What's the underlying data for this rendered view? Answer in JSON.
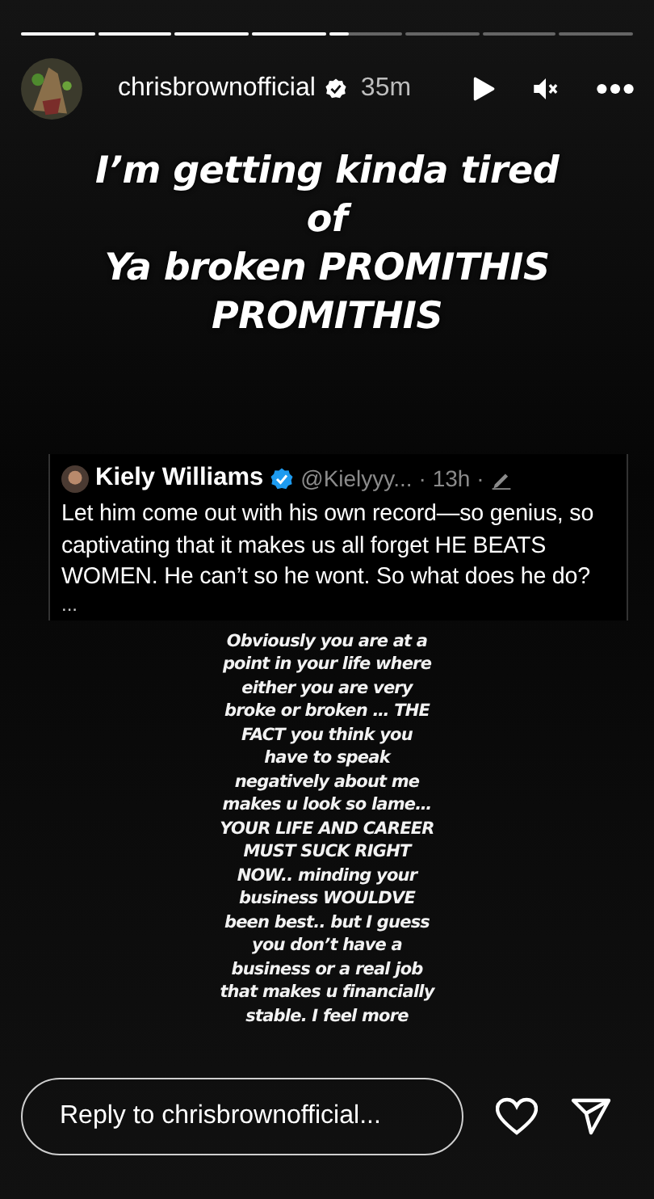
{
  "progress": [
    {
      "level": 1
    },
    {
      "level": 1
    },
    {
      "level": 1
    },
    {
      "level": 1
    },
    {
      "level": 0.28
    },
    {
      "level": 0
    },
    {
      "level": 0
    },
    {
      "level": 0
    }
  ],
  "header": {
    "username": "chrisbrownofficial",
    "verified": true,
    "time": "35m",
    "muted": true
  },
  "headline": [
    "I’m getting kinda tired",
    "of",
    "Ya broken PROMITHIS",
    "PROMITHIS"
  ],
  "tweet": {
    "name": "Kiely Williams",
    "verified": true,
    "handle": "@Kielyyy...",
    "time": "· 13h ·",
    "text": "Let him come out with his own record—so genius, so captivating that it makes us all forget HE BEATS WOMEN. He can’t so he wont. So what does he do?",
    "more": "..."
  },
  "caption": [
    "Obviously you are at a",
    "point in your life where",
    "either you are very",
    "broke or broken … THE",
    "FACT you think you",
    "have to speak",
    "negatively about me",
    "makes u look so lame…",
    "YOUR LIFE AND CAREER",
    "MUST SUCK RIGHT",
    "NOW.. minding your",
    "business WOULDVE",
    "been best.. but I guess",
    "you don’t have a",
    "business or a real job",
    "that makes u financially",
    "stable.  I feel more"
  ],
  "reply": {
    "placeholder": "Reply to chrisbrownofficial..."
  }
}
